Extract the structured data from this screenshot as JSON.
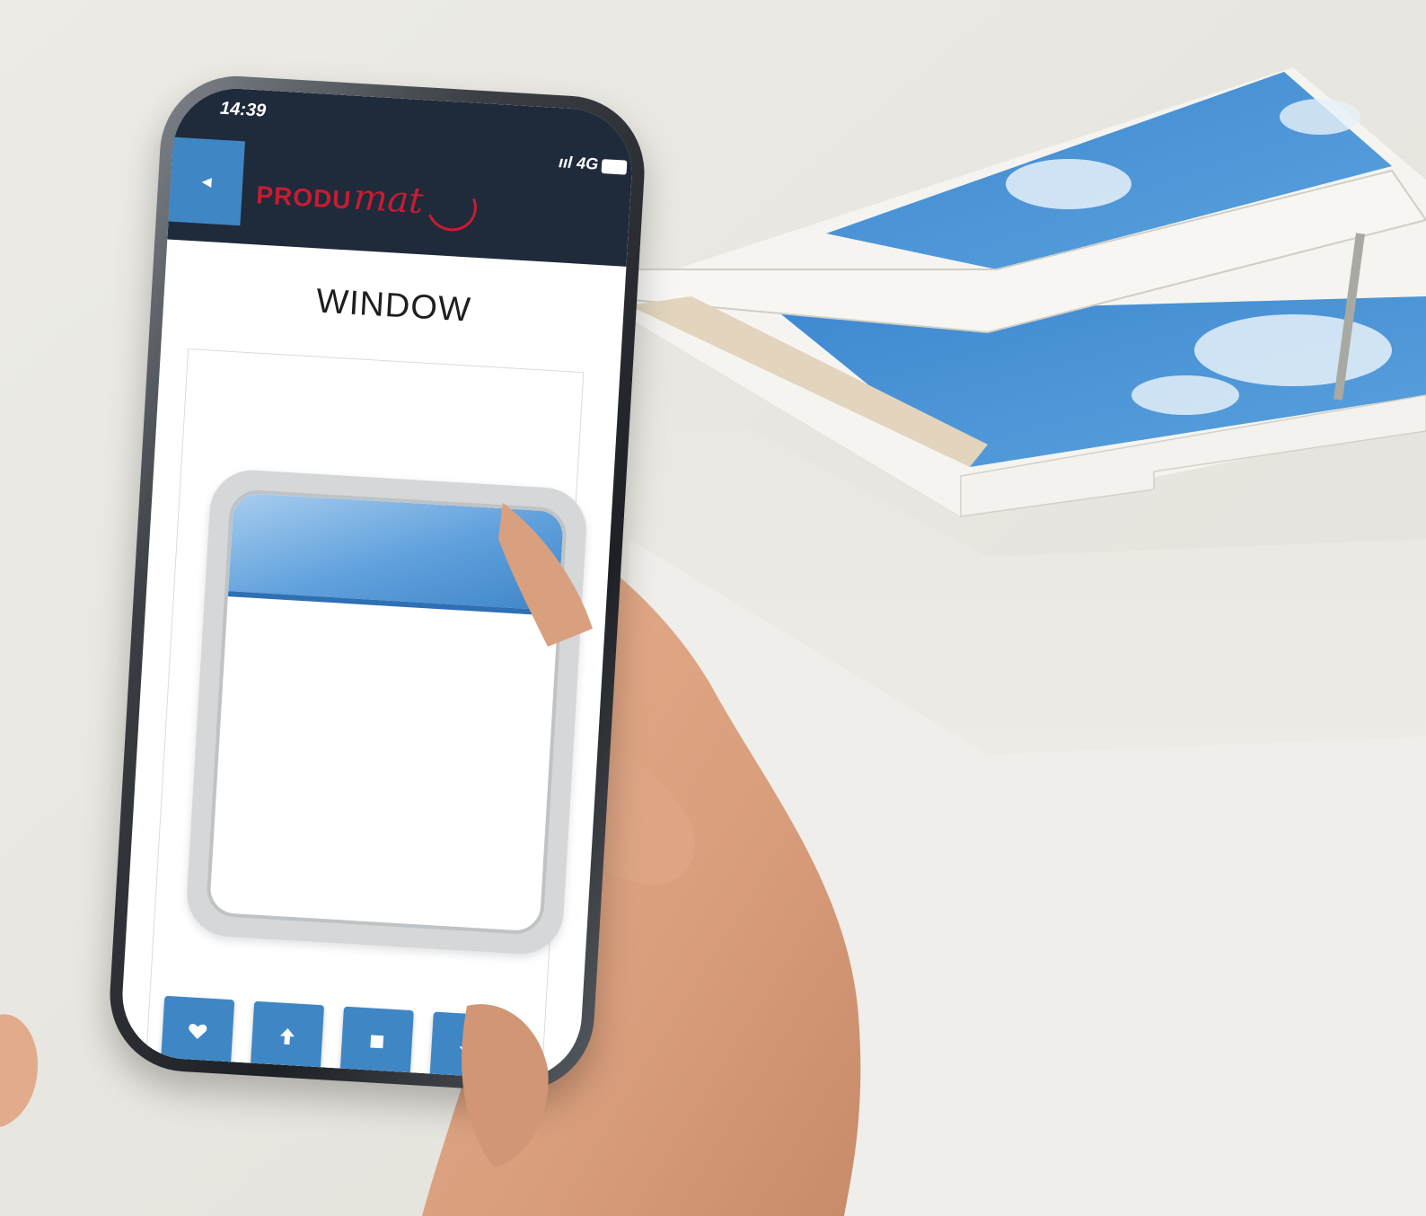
{
  "status_bar": {
    "time": "14:39",
    "signal": "ııl 4G"
  },
  "header": {
    "brand_part1": "PRODU",
    "brand_part2": "mat"
  },
  "page": {
    "title": "WINDOW"
  },
  "icons": {
    "back": "back-arrow-icon",
    "favorite": "heart-icon",
    "up": "arrow-up-icon",
    "stop": "stop-square-icon",
    "down": "arrow-down-icon"
  },
  "colors": {
    "header_bg": "#1f2a3b",
    "accent_blue": "#3f86c4",
    "brand_red": "#c51d32",
    "sky_blue": "#4a93d6"
  }
}
